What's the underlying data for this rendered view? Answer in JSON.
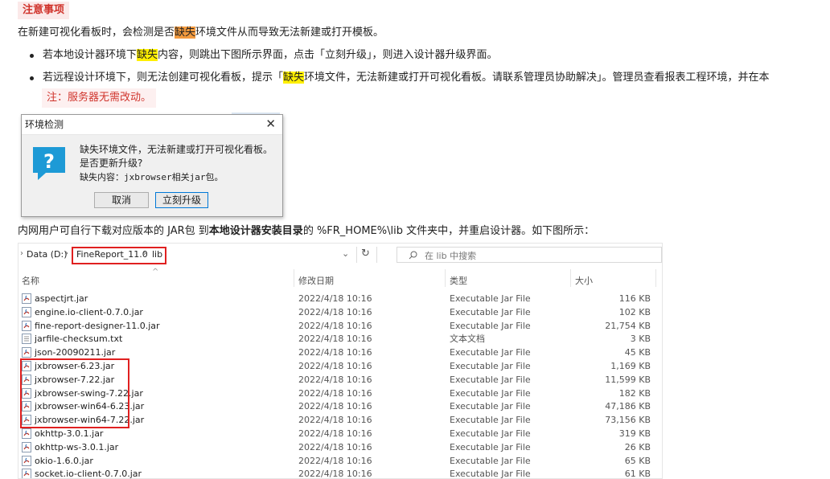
{
  "note": {
    "title": "注意事项",
    "intro_pre": "在新建可视化看板时，会检测是否",
    "intro_hl": "缺失",
    "intro_post": "环境文件从而导致无法新建或打开模板。",
    "b1_pre": "若本地设计器环境下",
    "b1_hl": "缺失",
    "b1_post": "内容，则跳出下图所示界面，点击「立刻升级」，则进入设计器升级界面。",
    "b2_pre": "若远程设计环境下，则无法创建可视化看板，提示「",
    "b2_hl": "缺失",
    "b2_post": "环境文件，无法新建或打开可视化看板。请联系管理员协助解决」。管理员查看报表工程环境，并在本",
    "sub_note": "注：服务器无需改动。"
  },
  "dialog": {
    "title": "环境检测",
    "close": "✕",
    "line1": "缺失环境文件，无法新建或打开可视化看板。",
    "line2": "是否更新升级?",
    "line3": "缺失内容：jxbrowser相关jar包。",
    "cancel": "取消",
    "upgrade": "立刻升级"
  },
  "instruction": {
    "pre": "内网用户可自行下载对应版本的 JAR包 到",
    "bold": "本地设计器安装目录",
    "post": "的 %FR_HOME%\\lib 文件夹中，并重启设计器。如下图所示："
  },
  "explorer": {
    "crumbs": [
      "Data (D:)",
      "FineReport_11.0",
      "lib"
    ],
    "search_placeholder": "在 lib 中搜索",
    "columns": [
      "名称",
      "修改日期",
      "类型",
      "大小"
    ],
    "files": [
      {
        "name": "aspectjrt.jar",
        "date": "2022/4/18 10:16",
        "type": "Executable Jar File",
        "size": "116 KB"
      },
      {
        "name": "engine.io-client-0.7.0.jar",
        "date": "2022/4/18 10:16",
        "type": "Executable Jar File",
        "size": "102 KB"
      },
      {
        "name": "fine-report-designer-11.0.jar",
        "date": "2022/4/18 10:16",
        "type": "Executable Jar File",
        "size": "21,754 KB"
      },
      {
        "name": "jarfile-checksum.txt",
        "date": "2022/4/18 10:16",
        "type": "文本文档",
        "size": "3 KB"
      },
      {
        "name": "json-20090211.jar",
        "date": "2022/4/18 10:16",
        "type": "Executable Jar File",
        "size": "45 KB"
      },
      {
        "name": "jxbrowser-6.23.jar",
        "date": "2022/4/18 10:16",
        "type": "Executable Jar File",
        "size": "1,169 KB"
      },
      {
        "name": "jxbrowser-7.22.jar",
        "date": "2022/4/18 10:16",
        "type": "Executable Jar File",
        "size": "11,599 KB"
      },
      {
        "name": "jxbrowser-swing-7.22.jar",
        "date": "2022/4/18 10:16",
        "type": "Executable Jar File",
        "size": "182 KB"
      },
      {
        "name": "jxbrowser-win64-6.23.jar",
        "date": "2022/4/18 10:16",
        "type": "Executable Jar File",
        "size": "47,186 KB"
      },
      {
        "name": "jxbrowser-win64-7.22.jar",
        "date": "2022/4/18 10:16",
        "type": "Executable Jar File",
        "size": "73,156 KB"
      },
      {
        "name": "okhttp-3.0.1.jar",
        "date": "2022/4/18 10:16",
        "type": "Executable Jar File",
        "size": "319 KB"
      },
      {
        "name": "okhttp-ws-3.0.1.jar",
        "date": "2022/4/18 10:16",
        "type": "Executable Jar File",
        "size": "26 KB"
      },
      {
        "name": "okio-1.6.0.jar",
        "date": "2022/4/18 10:16",
        "type": "Executable Jar File",
        "size": "65 KB"
      },
      {
        "name": "socket.io-client-0.7.0.jar",
        "date": "2022/4/18 10:16",
        "type": "Executable Jar File",
        "size": "61 KB"
      }
    ]
  }
}
